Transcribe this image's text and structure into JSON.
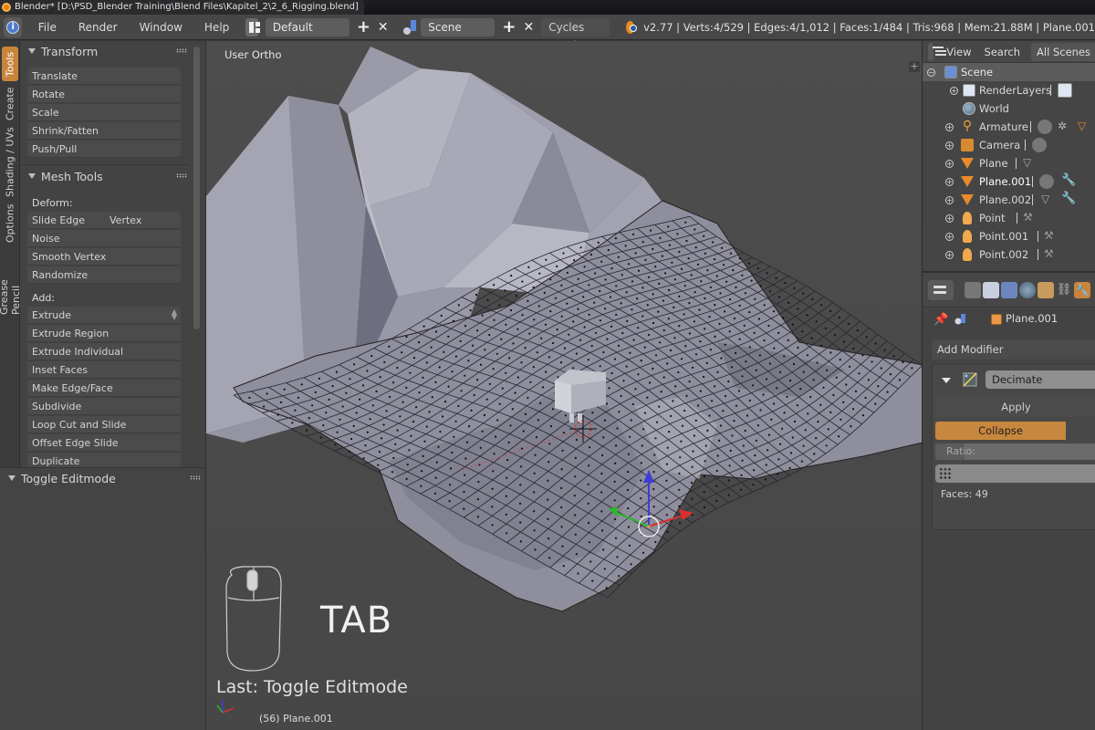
{
  "window": {
    "title": "Blender* [D:\\PSD_Blender Training\\Blend Files\\Kapitel_2\\2_6_Rigging.blend]"
  },
  "menubar": {
    "menus": [
      "File",
      "Render",
      "Window",
      "Help"
    ],
    "screen_layout": "Default",
    "scene": "Scene",
    "render_engine": "Cycles Render",
    "stats": "v2.77 | Verts:4/529 | Edges:4/1,012 | Faces:1/484 | Tris:968 | Mem:21.88M | Plane.001",
    "add_symbol": "+",
    "close_symbol": "✕"
  },
  "tool_tabs": [
    {
      "label": "Tools",
      "active": true
    },
    {
      "label": "Create",
      "active": false
    },
    {
      "label": "Shading / UVs",
      "active": false
    },
    {
      "label": "Options",
      "active": false
    },
    {
      "label": "Grease Pencil",
      "active": false
    }
  ],
  "tools": {
    "transform": {
      "title": "Transform",
      "buttons": [
        "Translate",
        "Rotate",
        "Scale",
        "Shrink/Fatten",
        "Push/Pull"
      ]
    },
    "mesh_tools": {
      "title": "Mesh Tools",
      "deform_label": "Deform:",
      "deform_buttons": [
        {
          "label": "Slide Edge",
          "secondary": "Vertex"
        },
        {
          "label": "Noise"
        },
        {
          "label": "Smooth Vertex"
        },
        {
          "label": "Randomize"
        }
      ],
      "add_label": "Add:",
      "add_dropdown": "Extrude",
      "add_buttons": [
        "Extrude Region",
        "Extrude Individual",
        "Inset Faces",
        "Make Edge/Face",
        "Subdivide",
        "Loop Cut and Slide",
        "Offset Edge Slide",
        "Duplicate"
      ]
    },
    "last_operator": {
      "title": "Toggle Editmode"
    }
  },
  "viewport": {
    "view_name": "User Ortho",
    "key_hint": "TAB",
    "last_operation": "Last: Toggle Editmode",
    "object_info": "(56) Plane.001",
    "plus": "+"
  },
  "outliner": {
    "header": {
      "view": "View",
      "search": "Search",
      "filter": "All Scenes"
    },
    "items": [
      {
        "name": "Scene",
        "type": "scene",
        "level": 0
      },
      {
        "name": "RenderLayers",
        "type": "renderlayers",
        "level": 1
      },
      {
        "name": "World",
        "type": "world",
        "level": 1
      },
      {
        "name": "Armature",
        "type": "armature",
        "level": 1
      },
      {
        "name": "Camera",
        "type": "camera",
        "level": 1
      },
      {
        "name": "Plane",
        "type": "mesh",
        "level": 1
      },
      {
        "name": "Plane.001",
        "type": "mesh",
        "level": 1,
        "selected": true,
        "has_modifier": true
      },
      {
        "name": "Plane.002",
        "type": "mesh",
        "level": 1,
        "has_modifier": true
      },
      {
        "name": "Point",
        "type": "lamp",
        "level": 1
      },
      {
        "name": "Point.001",
        "type": "lamp",
        "level": 1
      },
      {
        "name": "Point.002",
        "type": "lamp",
        "level": 1
      }
    ]
  },
  "properties": {
    "tabs": [
      "render",
      "render-layers",
      "scene",
      "world",
      "object",
      "constraints",
      "modifiers"
    ],
    "active_tab": "modifiers",
    "context_object": "Plane.001",
    "add_modifier": "Add Modifier",
    "modifier": {
      "name": "Decimate",
      "apply": "Apply",
      "mode": "Collapse",
      "ratio_label": "Ratio:",
      "faces": "Faces: 49"
    }
  },
  "colors": {
    "accent": "#c9843b",
    "active_tab": "#c9843b",
    "mesh_icon": "#e88a2a",
    "panel_bg": "#434343",
    "viewport_bg": "#4a4a4a"
  }
}
